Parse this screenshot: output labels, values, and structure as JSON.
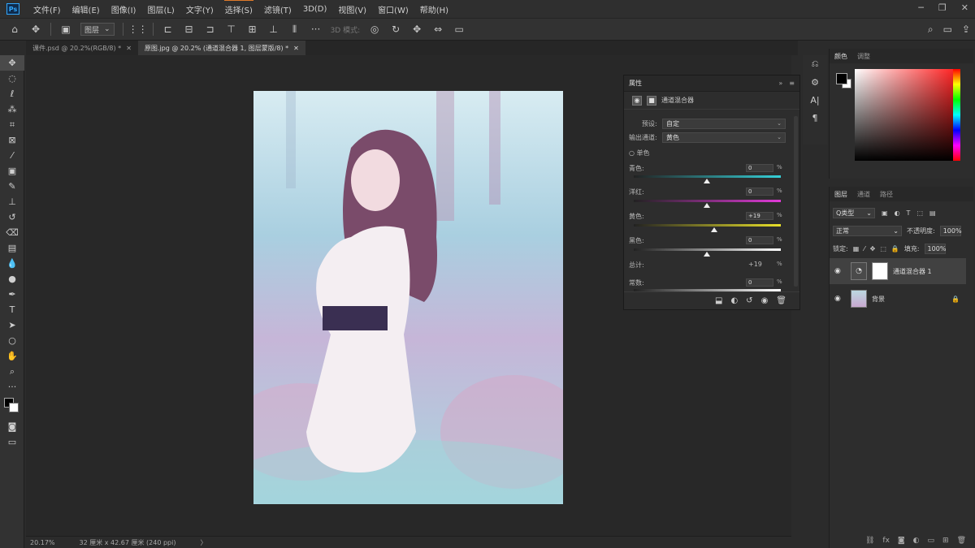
{
  "app": {
    "logo": "Ps"
  },
  "menu": [
    "文件(F)",
    "编辑(E)",
    "图像(I)",
    "图层(L)",
    "文字(Y)",
    "选择(S)",
    "滤镜(T)",
    "3D(D)",
    "视图(V)",
    "窗口(W)",
    "帮助(H)"
  ],
  "window_controls": [
    "─",
    "❐",
    "✕"
  ],
  "options_bar": {
    "layer_select": "图层",
    "mode_3d_label": "3D 模式:"
  },
  "tabs": [
    {
      "label": "课件.psd @ 20.2%(RGB/8) *",
      "close": "✕"
    },
    {
      "label": "原图.jpg @ 20.2% (通道混合器 1, 图层蒙版/8) *",
      "close": "✕"
    }
  ],
  "status": {
    "zoom": "20.17%",
    "doc_info": "32 厘米 x 42.67 厘米 (240 ppi)",
    "arrow": "〉"
  },
  "properties": {
    "panel_title": "属性",
    "adjustment_title": "通道混合器",
    "preset_label": "预设:",
    "preset_value": "自定",
    "output_label": "输出通道:",
    "output_value": "黄色",
    "mono_label": "单色",
    "sliders": [
      {
        "label": "青色:",
        "value": "0",
        "pct": "%"
      },
      {
        "label": "洋红:",
        "value": "0",
        "pct": "%"
      },
      {
        "label": "黄色:",
        "value": "+19",
        "pct": "%"
      },
      {
        "label": "黑色:",
        "value": "0",
        "pct": "%"
      }
    ],
    "total_label": "总计:",
    "total_value": "+19",
    "total_pct": "%",
    "constant_label": "常数:",
    "constant_value": "0",
    "constant_pct": "%"
  },
  "color_panel": {
    "tab_color": "颜色",
    "tab_adjust": "调整"
  },
  "layers_panel": {
    "tab_layers": "图层",
    "tab_channels": "通道",
    "tab_paths": "路径",
    "filter_kind": "Q类型",
    "blend_mode": "正常",
    "opacity_label": "不透明度:",
    "opacity_value": "100%",
    "lock_label": "锁定:",
    "fill_label": "填充:",
    "fill_value": "100%",
    "layers": [
      {
        "name": "通道混合器 1"
      },
      {
        "name": "背景"
      }
    ]
  },
  "colors": {
    "accent": "#31a8ff",
    "menu_highlight": "#e07a2a"
  }
}
